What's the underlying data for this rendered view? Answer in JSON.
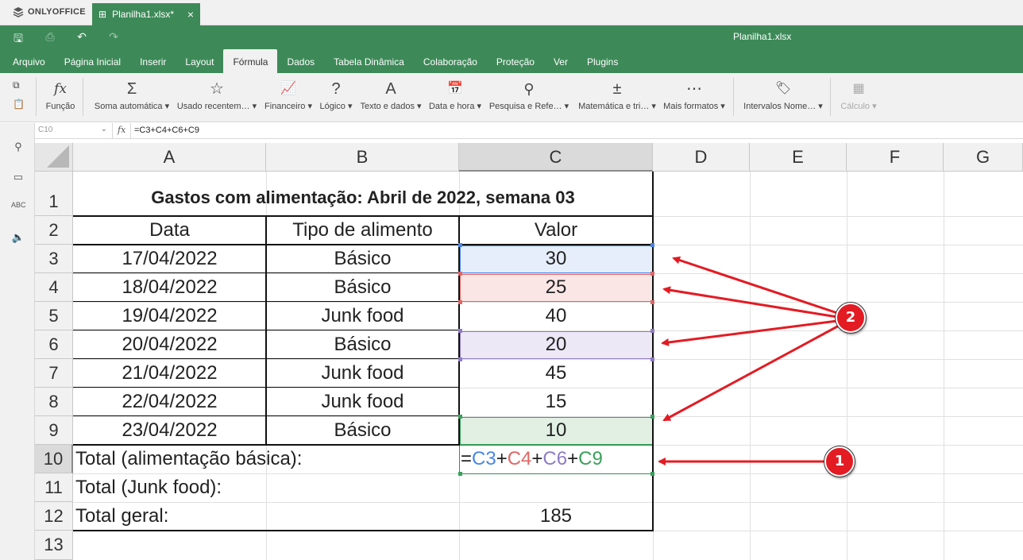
{
  "app": {
    "brand": "ONLYOFFICE",
    "tab_title": "Planilha1.xlsx*",
    "window_title": "Planilha1.xlsx"
  },
  "menu": [
    "Arquivo",
    "Página Inicial",
    "Inserir",
    "Layout",
    "Fórmula",
    "Dados",
    "Tabela Dinâmica",
    "Colaboração",
    "Proteção",
    "Ver",
    "Plugins"
  ],
  "menu_active": "Fórmula",
  "ribbon": {
    "funcao": "Função",
    "soma": "Soma automática",
    "usado": "Usado recentem…",
    "financeiro": "Financeiro",
    "logico": "Lógico",
    "texto": "Texto e dados",
    "data": "Data e hora",
    "pesquisa": "Pesquisa e Refe…",
    "matematica": "Matemática e tri…",
    "mais": "Mais formatos",
    "intervalos": "Intervalos Nome…",
    "calculo": "Cálculo"
  },
  "formula_bar": {
    "cell_ref": "C10",
    "fx": "fx",
    "formula": "=C3+C4+C6+C9"
  },
  "columns": [
    "A",
    "B",
    "C",
    "D",
    "E",
    "F",
    "G"
  ],
  "rows": [
    "1",
    "2",
    "3",
    "4",
    "5",
    "6",
    "7",
    "8",
    "9",
    "10",
    "11",
    "12",
    "13"
  ],
  "sheet": {
    "title": "Gastos com alimentação: Abril de 2022, semana 03",
    "headers": {
      "a": "Data",
      "b": "Tipo de alimento",
      "c": "Valor"
    },
    "data_rows": [
      {
        "date": "17/04/2022",
        "type": "Básico",
        "value": "30"
      },
      {
        "date": "18/04/2022",
        "type": "Básico",
        "value": "25"
      },
      {
        "date": "19/04/2022",
        "type": "Junk food",
        "value": "40"
      },
      {
        "date": "20/04/2022",
        "type": "Básico",
        "value": "20"
      },
      {
        "date": "21/04/2022",
        "type": "Junk food",
        "value": "45"
      },
      {
        "date": "22/04/2022",
        "type": "Junk food",
        "value": "15"
      },
      {
        "date": "23/04/2022",
        "type": "Básico",
        "value": "10"
      }
    ],
    "total_basic_label": "Total (alimentação básica):",
    "total_junk_label": "Total (Junk food):",
    "total_label": "Total geral:",
    "total_value": "185",
    "edit_formula": {
      "eq": "=",
      "p1": "C3",
      "plus1": "+",
      "p2": "C4",
      "plus2": "+",
      "p3": "C6",
      "plus3": "+",
      "p4": "C9"
    }
  },
  "annotations": {
    "badge1": "1",
    "badge2": "2"
  },
  "colors": {
    "brand_green": "#3d8a58",
    "ref_blue": "#4a86e8",
    "ref_red": "#e06666",
    "ref_purple": "#8e7cc3",
    "ref_green": "#38a05a",
    "arrow_red": "#e31b23"
  }
}
